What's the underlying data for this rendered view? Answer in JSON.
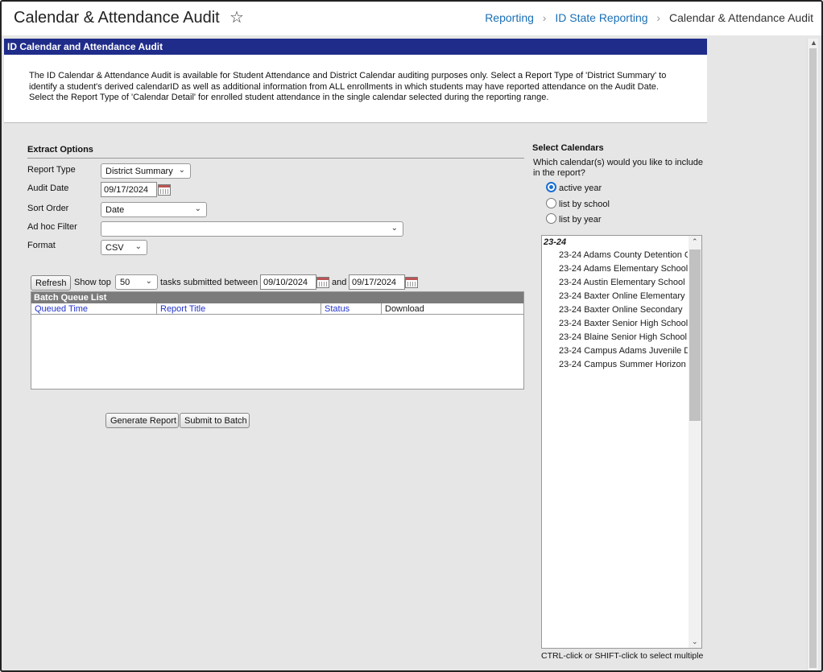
{
  "header": {
    "title": "Calendar & Attendance Audit",
    "breadcrumbs": [
      "Reporting",
      "ID State Reporting",
      "Calendar & Attendance Audit"
    ]
  },
  "panel": {
    "title": "ID Calendar and Attendance Audit",
    "description": "The ID Calendar & Attendance Audit is available for Student Attendance and District Calendar auditing purposes only. Select a Report Type of 'District Summary' to identify a student's derived calendarID as well as additional information from ALL enrollments in which students may have reported attendance on the Audit Date. Select the Report Type of 'Calendar Detail' for enrolled student attendance in the single calendar selected during the reporting range."
  },
  "extract": {
    "heading": "Extract Options",
    "report_type": {
      "label": "Report Type",
      "value": "District Summary"
    },
    "audit_date": {
      "label": "Audit Date",
      "value": "09/17/2024"
    },
    "sort_order": {
      "label": "Sort Order",
      "value": "Date"
    },
    "adhoc_filter": {
      "label": "Ad hoc Filter",
      "value": ""
    },
    "format": {
      "label": "Format",
      "value": "CSV"
    }
  },
  "batch": {
    "refresh_label": "Refresh",
    "show_top_label": "Show top",
    "show_top_value": "50",
    "between_label": "tasks submitted between",
    "start_date": "09/10/2024",
    "and_label": "and",
    "end_date": "09/17/2024",
    "list_title": "Batch Queue List",
    "columns": [
      "Queued Time",
      "Report Title",
      "Status",
      "Download"
    ]
  },
  "actions": {
    "generate_label": "Generate Report",
    "submit_label": "Submit to Batch"
  },
  "calendars": {
    "heading": "Select Calendars",
    "question": "Which calendar(s) would you like to include in the report?",
    "options": [
      "active year",
      "list by school",
      "list by year"
    ],
    "selected_option": "active year",
    "group": "23-24",
    "items": [
      "23-24 Adams County Detention C",
      "23-24 Adams Elementary School",
      "23-24 Austin Elementary School",
      "23-24 Baxter Online Elementary",
      "23-24 Baxter Online Secondary",
      "23-24 Baxter Senior High School",
      "23-24 Blaine Senior High School",
      "23-24 Campus Adams Juvenile D",
      "23-24 Campus Summer Horizon"
    ],
    "hint": "CTRL-click or SHIFT-click to select multiple"
  },
  "colors": {
    "header_bar": "#1f2c8a",
    "link": "#1a6fb5",
    "radio_selected": "#1a6fd1"
  }
}
